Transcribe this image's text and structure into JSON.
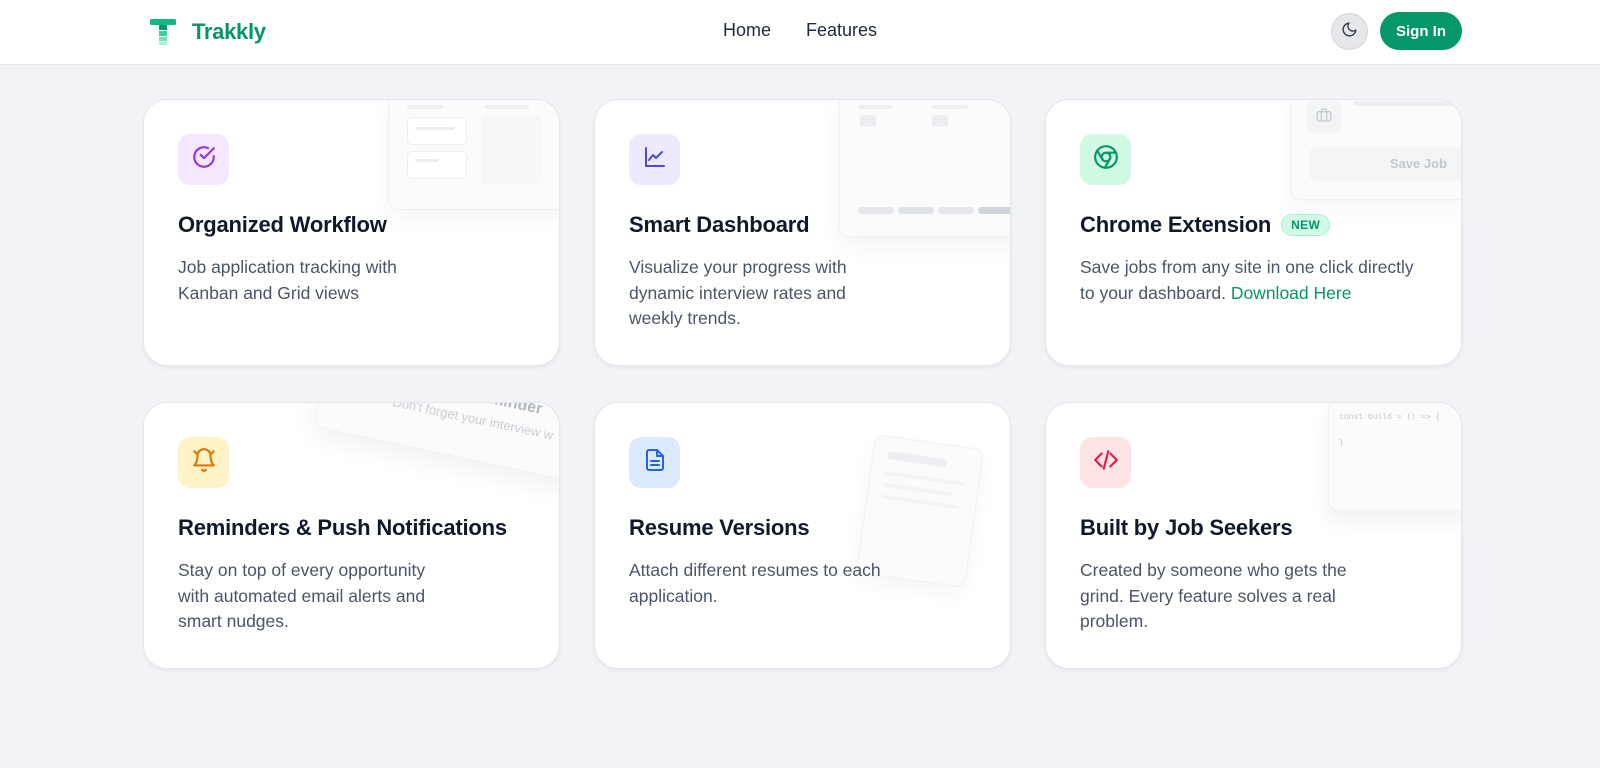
{
  "nav": {
    "brand": "Trakkly",
    "links": [
      "Home",
      "Features"
    ],
    "theme_toggle_icon": "moon-icon",
    "signin_label": "Sign In"
  },
  "colors": {
    "brand": "#059669",
    "page_bg": "#f1f3f7"
  },
  "cards": [
    {
      "icon": "check-circle-icon",
      "icon_color": "#9333ea",
      "icon_bg": "#f3e8ff",
      "title": "Organized Workflow",
      "desc": "Job application tracking with Kanban and Grid views"
    },
    {
      "icon": "line-chart-icon",
      "icon_color": "#4f46e5",
      "icon_bg": "#ede9fe",
      "title": "Smart Dashboard",
      "desc": "Visualize your progress with dynamic interview rates and weekly trends."
    },
    {
      "icon": "chrome-icon",
      "icon_color": "#059669",
      "icon_bg": "#d1fae5",
      "title": "Chrome Extension",
      "badge": "NEW",
      "desc": "Save jobs from any site in one click directly to your dashboard.",
      "link": "Download Here",
      "preview_button": "Save Job"
    },
    {
      "icon": "bell-icon",
      "icon_color": "#d97706",
      "icon_bg": "#fef3c7",
      "title": "Reminders & Push Notifications",
      "desc": "Stay on top of every opportunity with automated email alerts and smart nudges.",
      "preview_title": "Interview Reminder",
      "preview_text": "Don't forget your interview w"
    },
    {
      "icon": "document-icon",
      "icon_color": "#2563eb",
      "icon_bg": "#dbeafe",
      "title": "Resume Versions",
      "desc": "Attach different resumes to each application."
    },
    {
      "icon": "code-icon",
      "icon_color": "#e11d48",
      "icon_bg": "#ffe4e6",
      "title": "Built by Job Seekers",
      "desc": "Created by someone who gets the grind. Every feature solves a real problem.",
      "preview_code_line1": "const build = () => {",
      "preview_code_line2": "}"
    }
  ]
}
